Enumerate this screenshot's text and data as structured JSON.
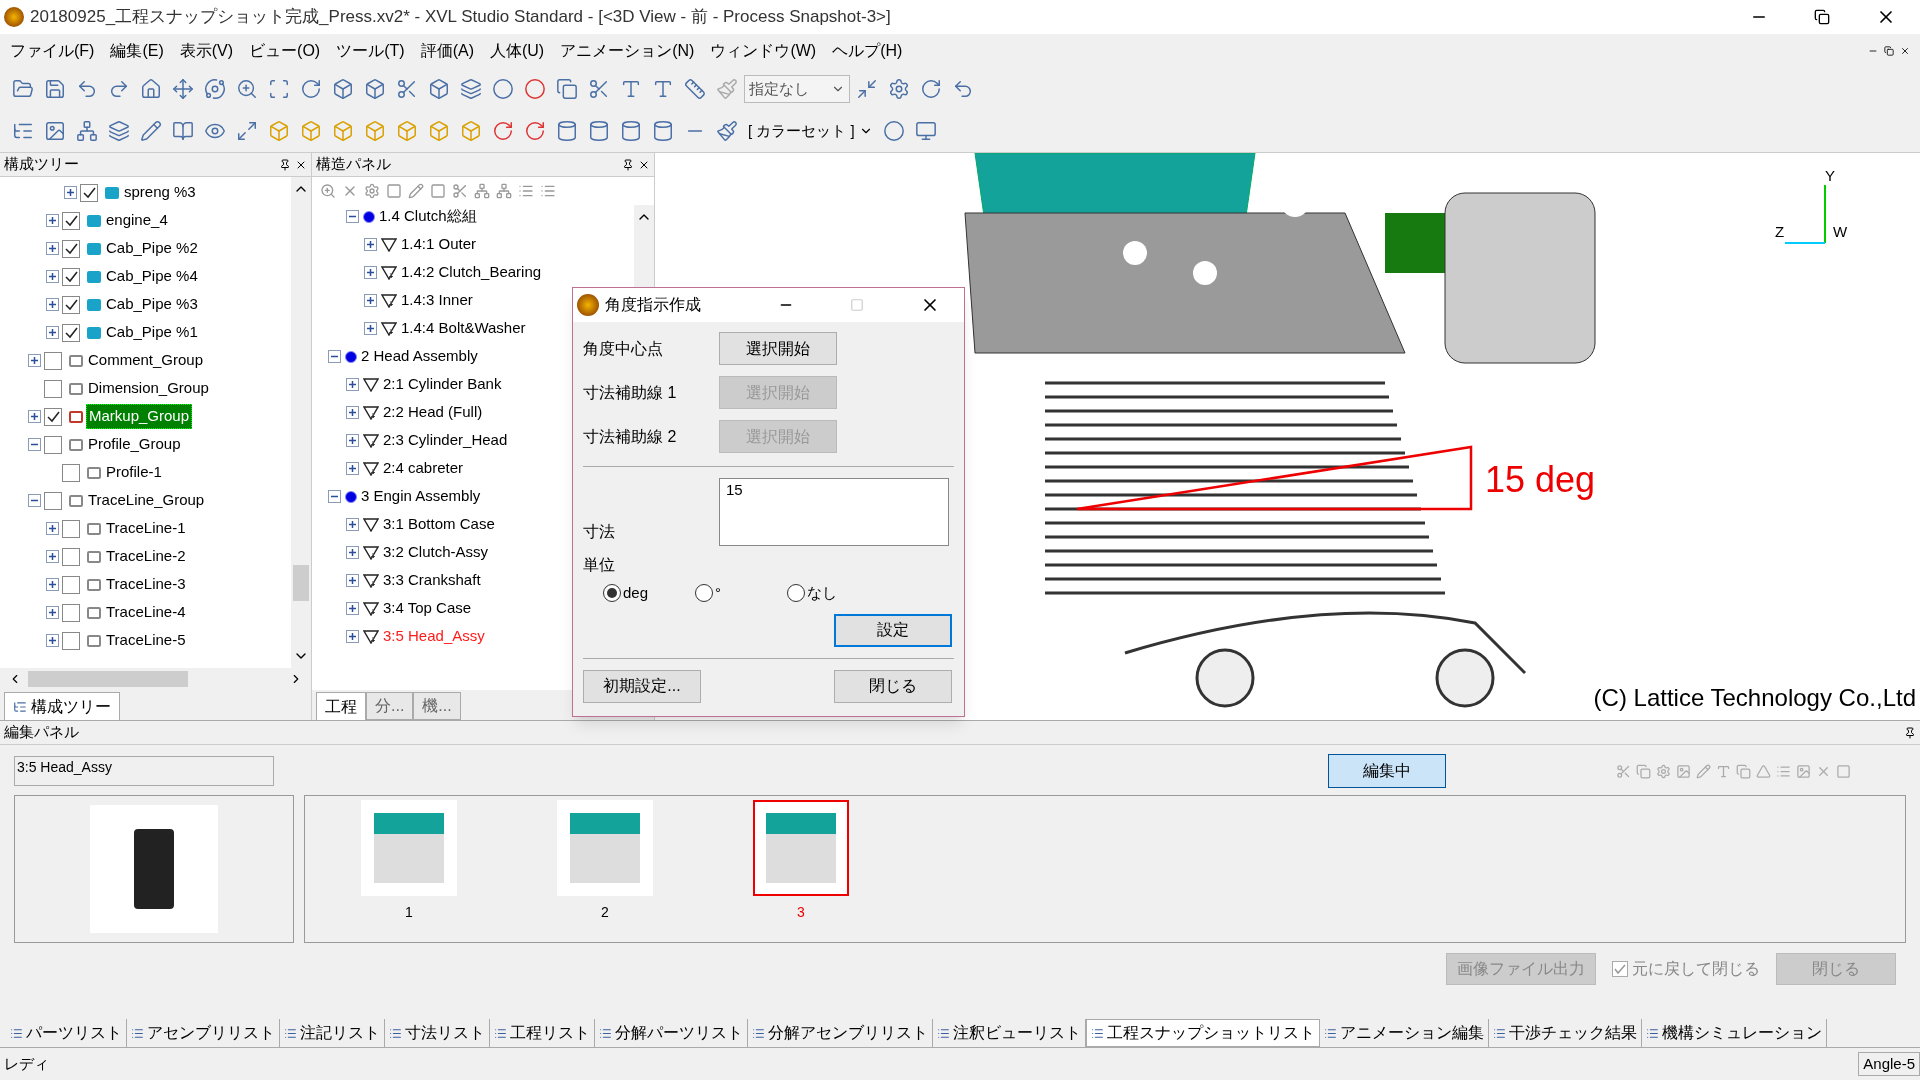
{
  "window": {
    "title": "20180925_工程スナップショット完成_Press.xv2* - XVL Studio Standard - [<3D View - 前 - Process Snapshot-3>]"
  },
  "menu": [
    "ファイル(F)",
    "編集(E)",
    "表示(V)",
    "ビュー(O)",
    "ツール(T)",
    "評価(A)",
    "人体(U)",
    "アニメーション(N)",
    "ウィンドウ(W)",
    "ヘルプ(H)"
  ],
  "toolbar": {
    "view_select": "指定なし",
    "color_set": "[ カラーセット ]"
  },
  "tree_panel": {
    "title": "構成ツリー",
    "items": [
      {
        "children": [
          {
            "children": [
              {
                "label": "spreng %3",
                "kind": "part",
                "checked": true,
                "expanded": false,
                "selected": false
              }
            ]
          },
          {
            "label": "engine_4",
            "kind": "part",
            "checked": true,
            "expanded": false,
            "selected": false
          },
          {
            "label": "Cab_Pipe %2",
            "kind": "part",
            "checked": true,
            "expanded": false,
            "selected": false
          },
          {
            "label": "Cab_Pipe %4",
            "kind": "part",
            "checked": true,
            "expanded": false,
            "selected": false
          },
          {
            "label": "Cab_Pipe %3",
            "kind": "part",
            "checked": true,
            "expanded": false,
            "selected": false
          },
          {
            "label": "Cab_Pipe %1",
            "kind": "part",
            "checked": true,
            "expanded": false,
            "selected": false
          }
        ]
      },
      {
        "label": "Comment_Group",
        "kind": "comment",
        "checked": false,
        "expanded": false,
        "selected": false
      },
      {
        "label": "Dimension_Group",
        "kind": "dimension",
        "checked": false,
        "selected": false
      },
      {
        "label": "Markup_Group",
        "kind": "markup",
        "checked": true,
        "expanded": false,
        "selected": true
      },
      {
        "label": "Profile_Group",
        "kind": "profile",
        "checked": false,
        "expanded": true,
        "selected": false,
        "children": [
          {
            "label": "Profile-1",
            "kind": "profile",
            "checked": false,
            "selected": false
          }
        ]
      },
      {
        "label": "TraceLine_Group",
        "kind": "traceline",
        "checked": false,
        "expanded": true,
        "selected": false,
        "children": [
          {
            "label": "TraceLine-1",
            "kind": "traceline",
            "checked": false,
            "expanded": false,
            "selected": false
          },
          {
            "label": "TraceLine-2",
            "kind": "traceline",
            "checked": false,
            "expanded": false,
            "selected": false
          },
          {
            "label": "TraceLine-3",
            "kind": "traceline",
            "checked": false,
            "expanded": false,
            "selected": false
          },
          {
            "label": "TraceLine-4",
            "kind": "traceline",
            "checked": false,
            "expanded": false,
            "selected": false
          },
          {
            "label": "TraceLine-5",
            "kind": "traceline",
            "checked": false,
            "expanded": false,
            "selected": false
          }
        ]
      }
    ],
    "tabs": [
      {
        "label": "構成ツリー",
        "selected": true
      }
    ]
  },
  "structure_panel": {
    "title": "構造パネル",
    "items": [
      {
        "children": [
          {
            "label": "1.4 Clutch総組",
            "kind": "assembly",
            "expanded": true,
            "selected": false,
            "children": [
              {
                "label": "1.4:1 Outer",
                "kind": "plain",
                "expanded": false,
                "selected": false
              },
              {
                "label": "1.4:2 Clutch_Bearing",
                "kind": "marked",
                "expanded": false,
                "selected": false
              },
              {
                "label": "1.4:3 Inner",
                "kind": "marked",
                "expanded": false,
                "selected": false
              },
              {
                "label": "1.4:4 Bolt&Washer",
                "kind": "marked",
                "expanded": false,
                "selected": false
              }
            ]
          }
        ]
      },
      {
        "label": "2 Head Assembly",
        "kind": "assembly",
        "expanded": true,
        "selected": false,
        "children": [
          {
            "label": "2:1 Cylinder Bank",
            "kind": "plain",
            "expanded": false,
            "selected": false
          },
          {
            "label": "2:2 Head (Full)",
            "kind": "marked",
            "expanded": false,
            "selected": false
          },
          {
            "label": "2:3 Cylinder_Head",
            "kind": "marked",
            "expanded": false,
            "selected": false
          },
          {
            "label": "2:4 cabreter",
            "kind": "marked",
            "expanded": false,
            "selected": false
          }
        ]
      },
      {
        "label": "3 Engin Assembly",
        "kind": "assembly",
        "expanded": true,
        "selected": false,
        "children": [
          {
            "label": "3:1 Bottom Case",
            "kind": "plain",
            "expanded": false,
            "selected": false
          },
          {
            "label": "3:2 Clutch-Assy",
            "kind": "marked",
            "expanded": false,
            "selected": false
          },
          {
            "label": "3:3 Crankshaft",
            "kind": "marked",
            "expanded": false,
            "selected": false
          },
          {
            "label": "3:4 Top Case",
            "kind": "marked",
            "expanded": false,
            "selected": false
          },
          {
            "label": "3:5 Head_Assy",
            "kind": "marked",
            "expanded": false,
            "selected": true
          }
        ]
      }
    ],
    "tabs": [
      {
        "label": "工程",
        "selected": true
      },
      {
        "label": "分...",
        "selected": false
      },
      {
        "label": "機...",
        "selected": false
      }
    ]
  },
  "view": {
    "annotation": "15 deg",
    "axes": [
      "Y",
      "Z",
      "W"
    ],
    "copyright": "(C) Lattice Technology Co.,Ltd"
  },
  "dialog": {
    "title": "角度指示作成",
    "rows": [
      {
        "label": "角度中心点",
        "button": "選択開始",
        "disabled": false
      },
      {
        "label": "寸法補助線 1",
        "button": "選択開始",
        "disabled": true
      },
      {
        "label": "寸法補助線 2",
        "button": "選択開始",
        "disabled": true
      }
    ],
    "dimension_label": "寸法",
    "dimension_value": "15",
    "unit_label": "単位",
    "units": [
      {
        "label": "deg",
        "selected": true
      },
      {
        "label": "°",
        "selected": false
      },
      {
        "label": "なし",
        "selected": false
      }
    ],
    "apply": "設定",
    "defaults": "初期設定...",
    "close": "閉じる"
  },
  "edit_panel": {
    "title": "編集パネル",
    "name": "3:5 Head_Assy",
    "edit_button": "編集中",
    "edit_active": true,
    "snapshots": [
      {
        "label": "1",
        "selected": false
      },
      {
        "label": "2",
        "selected": false
      },
      {
        "label": "3",
        "selected": true
      }
    ],
    "export": {
      "label": "画像ファイル出力",
      "disabled": true
    },
    "restore": {
      "label": "元に戻して閉じる",
      "checked": true,
      "disabled": true
    },
    "close": {
      "label": "閉じる",
      "disabled": true
    }
  },
  "bottom_tabs": [
    {
      "label": "パーツリスト",
      "selected": false
    },
    {
      "label": "アセンブリリスト",
      "selected": false
    },
    {
      "label": "注記リスト",
      "selected": false
    },
    {
      "label": "寸法リスト",
      "selected": false
    },
    {
      "label": "工程リスト",
      "selected": false
    },
    {
      "label": "分解パーツリスト",
      "selected": false
    },
    {
      "label": "分解アセンブリリスト",
      "selected": false
    },
    {
      "label": "注釈ビューリスト",
      "selected": false
    },
    {
      "label": "工程スナップショットリスト",
      "selected": true
    },
    {
      "label": "アニメーション編集",
      "selected": false
    },
    {
      "label": "干渉チェック結果",
      "selected": false
    },
    {
      "label": "機構シミュレーション",
      "selected": false
    }
  ],
  "status_bar": {
    "message": "レディ",
    "mode": "Angle-5"
  }
}
